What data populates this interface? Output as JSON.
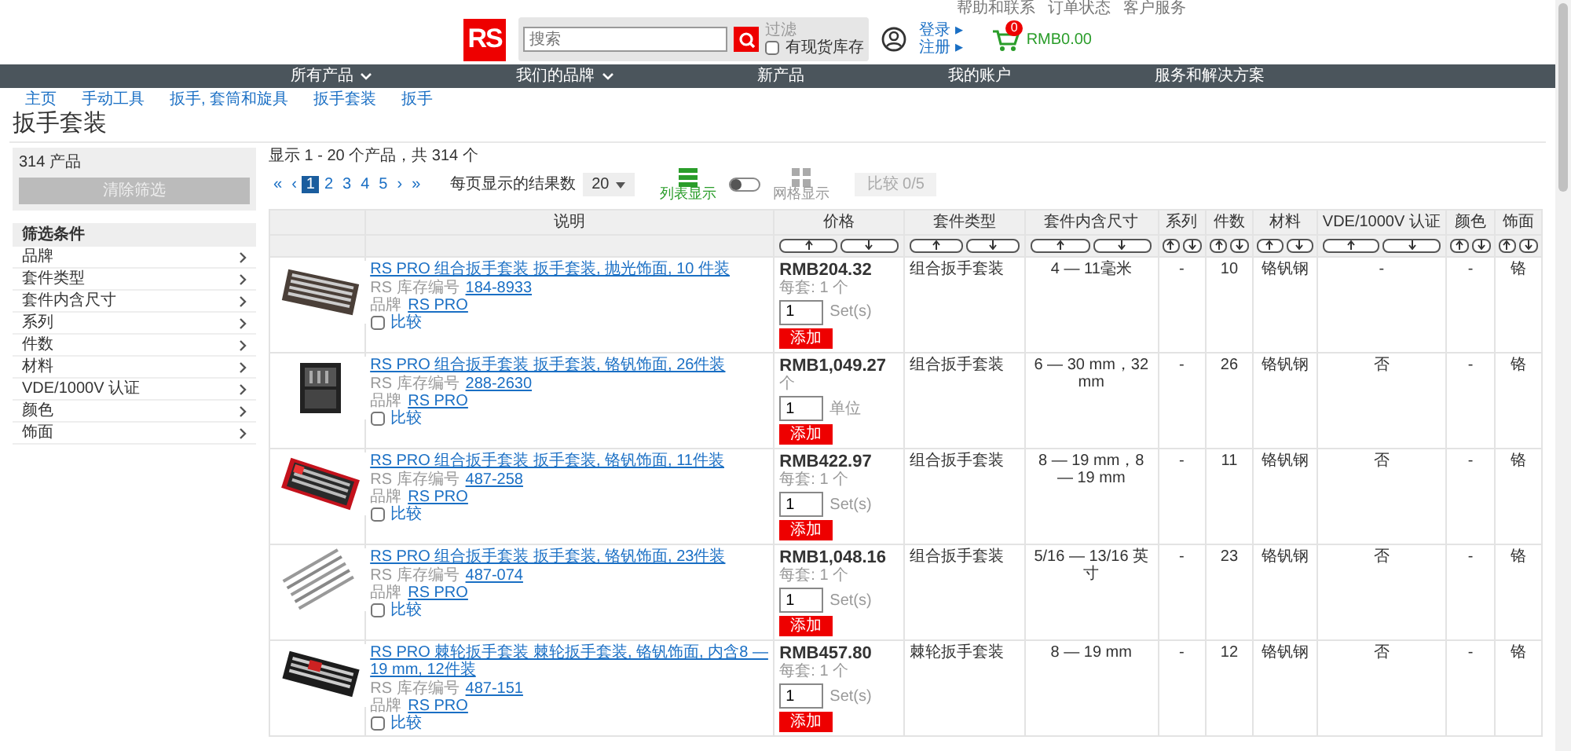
{
  "top_links": [
    "帮助和联系",
    "订单状态",
    "客户服务"
  ],
  "logo": "RS",
  "search": {
    "placeholder": "搜索"
  },
  "stock_filter": {
    "heading": "过滤",
    "label": "有现货库存",
    "checked": false
  },
  "account": [
    "登录 ▸",
    "注册 ▸"
  ],
  "cart": {
    "count": "0",
    "total": "RMB0.00"
  },
  "nav": [
    {
      "label": "所有产品",
      "dropdown": true
    },
    {
      "label": "我们的品牌",
      "dropdown": true
    },
    {
      "label": "新产品",
      "dropdown": false
    },
    {
      "label": "我的账户",
      "dropdown": false
    },
    {
      "label": "服务和解决方案",
      "dropdown": false
    }
  ],
  "breadcrumb": [
    "主页",
    "手动工具",
    "扳手, 套筒和旋具",
    "扳手套装",
    "扳手"
  ],
  "title": "扳手套装",
  "sidebar": {
    "count": "314 产品",
    "clear_button": {
      "label": "清除筛选",
      "disabled": true
    },
    "filter_heading": "筛选条件",
    "filters": [
      "品牌",
      "套件类型",
      "套件内含尺寸",
      "系列",
      "件数",
      "材料",
      "VDE/1000V 认证",
      "颜色",
      "饰面"
    ]
  },
  "results": {
    "summary": "显示 1 - 20 个产品，共 314 个",
    "pagination": [
      {
        "label": "«",
        "selected": false
      },
      {
        "label": "‹",
        "selected": false
      },
      {
        "label": "1",
        "selected": true
      },
      {
        "label": "2",
        "selected": false
      },
      {
        "label": "3",
        "selected": false
      },
      {
        "label": "4",
        "selected": false
      },
      {
        "label": "5",
        "selected": false
      },
      {
        "label": "›",
        "selected": false
      },
      {
        "label": "»",
        "selected": false
      }
    ],
    "per_page": {
      "label": "每页显示的结果数",
      "value": "20"
    },
    "views": [
      {
        "label": "列表显示",
        "selected": true
      },
      {
        "label": "网格显示",
        "selected": false
      }
    ],
    "compare_button": {
      "label": "比较 0/5",
      "disabled": true
    }
  },
  "table": {
    "columns": [
      {
        "sortable": false
      },
      {
        "label": "说明",
        "sortable": false
      },
      {
        "label": "价格",
        "sortable": true
      },
      {
        "label": "套件类型",
        "sortable": true
      },
      {
        "label": "套件内含尺寸",
        "sortable": true
      },
      {
        "label": "系列",
        "sortable": true
      },
      {
        "label": "件数",
        "sortable": true
      },
      {
        "label": "材料",
        "sortable": true
      },
      {
        "label": "VDE/1000V 认证",
        "sortable": true
      },
      {
        "label": "颜色",
        "sortable": true
      },
      {
        "label": "饰面",
        "sortable": true
      }
    ],
    "rows": [
      {
        "cells": [
          {
            "kind": "picture"
          },
          {
            "kind": "description",
            "title": "RS PRO 组合扳手套装 扳手套装, 抛光饰面, 10 件装",
            "stock_label": "RS 库存编号",
            "stock_no": "184-8933",
            "brand_label": "品牌",
            "brand": "RS PRO",
            "compare": {
              "label": "比较",
              "checked": false
            }
          },
          {
            "kind": "price",
            "price": "RMB204.32",
            "per": "每套: 1 个",
            "qty": "1",
            "unit": "Set(s)",
            "add": "添加"
          },
          {
            "kind": "text",
            "text": "组合扳手套装"
          },
          {
            "kind": "text",
            "text": "4 — 11毫米"
          },
          {
            "kind": "text",
            "text": "-"
          },
          {
            "kind": "text",
            "text": "10"
          },
          {
            "kind": "text",
            "text": "铬钒钢"
          },
          {
            "kind": "text",
            "text": "-"
          },
          {
            "kind": "text",
            "text": "-"
          },
          {
            "kind": "text",
            "text": "铬"
          }
        ]
      },
      {
        "cells": [
          {
            "kind": "picture"
          },
          {
            "kind": "description",
            "title": "RS PRO 组合扳手套装 扳手套装, 铬钒饰面, 26件装",
            "stock_label": "RS 库存编号",
            "stock_no": "288-2630",
            "brand_label": "品牌",
            "brand": "RS PRO",
            "compare": {
              "label": "比较",
              "checked": false
            }
          },
          {
            "kind": "price",
            "price": "RMB1,049.27",
            "per": "个",
            "qty": "1",
            "unit": "单位",
            "add": "添加"
          },
          {
            "kind": "text",
            "text": "组合扳手套装"
          },
          {
            "kind": "text",
            "text": "6 — 30 mm，32 mm"
          },
          {
            "kind": "text",
            "text": "-"
          },
          {
            "kind": "text",
            "text": "26"
          },
          {
            "kind": "text",
            "text": "铬钒钢"
          },
          {
            "kind": "text",
            "text": "否"
          },
          {
            "kind": "text",
            "text": "-"
          },
          {
            "kind": "text",
            "text": "铬"
          }
        ]
      },
      {
        "cells": [
          {
            "kind": "picture"
          },
          {
            "kind": "description",
            "title": "RS PRO 组合扳手套装 扳手套装, 铬钒饰面, 11件装",
            "stock_label": "RS 库存编号",
            "stock_no": "487-258",
            "brand_label": "品牌",
            "brand": "RS PRO",
            "compare": {
              "label": "比较",
              "checked": false
            }
          },
          {
            "kind": "price",
            "price": "RMB422.97",
            "per": "每套: 1 个",
            "qty": "1",
            "unit": "Set(s)",
            "add": "添加"
          },
          {
            "kind": "text",
            "text": "组合扳手套装"
          },
          {
            "kind": "text",
            "text": "8 — 19 mm，8 — 19 mm"
          },
          {
            "kind": "text",
            "text": "-"
          },
          {
            "kind": "text",
            "text": "11"
          },
          {
            "kind": "text",
            "text": "铬钒钢"
          },
          {
            "kind": "text",
            "text": "否"
          },
          {
            "kind": "text",
            "text": "-"
          },
          {
            "kind": "text",
            "text": "铬"
          }
        ]
      },
      {
        "cells": [
          {
            "kind": "picture"
          },
          {
            "kind": "description",
            "title": "RS PRO 组合扳手套装 扳手套装, 铬钒饰面, 23件装",
            "stock_label": "RS 库存编号",
            "stock_no": "487-074",
            "brand_label": "品牌",
            "brand": "RS PRO",
            "compare": {
              "label": "比较",
              "checked": false
            }
          },
          {
            "kind": "price",
            "price": "RMB1,048.16",
            "per": "每套: 1 个",
            "qty": "1",
            "unit": "Set(s)",
            "add": "添加"
          },
          {
            "kind": "text",
            "text": "组合扳手套装"
          },
          {
            "kind": "text",
            "text": "5/16 — 13/16 英寸"
          },
          {
            "kind": "text",
            "text": "-"
          },
          {
            "kind": "text",
            "text": "23"
          },
          {
            "kind": "text",
            "text": "铬钒钢"
          },
          {
            "kind": "text",
            "text": "否"
          },
          {
            "kind": "text",
            "text": "-"
          },
          {
            "kind": "text",
            "text": "铬"
          }
        ]
      },
      {
        "cells": [
          {
            "kind": "picture"
          },
          {
            "kind": "description",
            "title": "RS PRO 棘轮扳手套装 棘轮扳手套装, 铬钒饰面, 内含8 — 19 mm, 12件装",
            "stock_label": "RS 库存编号",
            "stock_no": "487-151",
            "brand_label": "品牌",
            "brand": "RS PRO",
            "compare": {
              "label": "比较",
              "checked": false
            }
          },
          {
            "kind": "price",
            "price": "RMB457.80",
            "per": "每套: 1 个",
            "qty": "1",
            "unit": "Set(s)",
            "add": "添加"
          },
          {
            "kind": "text",
            "text": "棘轮扳手套装"
          },
          {
            "kind": "text",
            "text": "8 — 19 mm"
          },
          {
            "kind": "text",
            "text": "-"
          },
          {
            "kind": "text",
            "text": "12"
          },
          {
            "kind": "text",
            "text": "铬钒钢"
          },
          {
            "kind": "text",
            "text": "否"
          },
          {
            "kind": "text",
            "text": "-"
          },
          {
            "kind": "text",
            "text": "铬"
          }
        ]
      }
    ]
  }
}
